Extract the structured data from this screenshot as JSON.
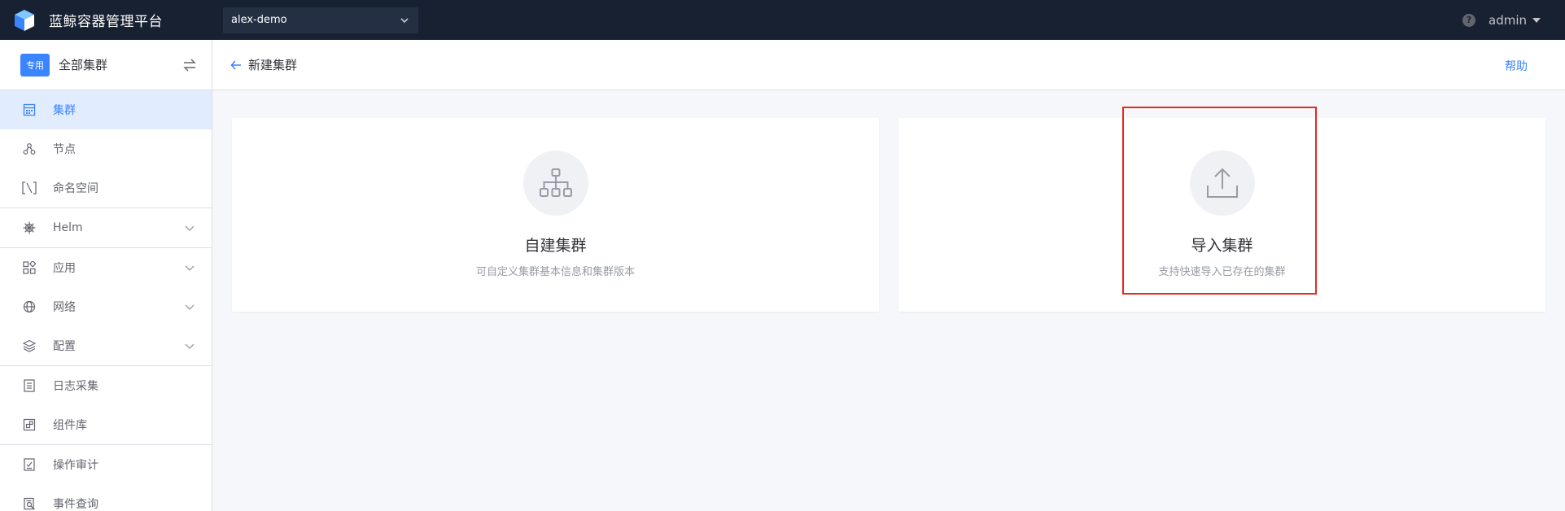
{
  "topbar": {
    "title": "蓝鲸容器管理平台",
    "project": "alex-demo",
    "help_icon_glyph": "?",
    "user": "admin"
  },
  "sidebar": {
    "tag": "专用",
    "cluster": "全部集群",
    "items": [
      {
        "label": "集群",
        "icon": "grid-icon",
        "active": true
      },
      {
        "label": "节点",
        "icon": "nodes-icon"
      },
      {
        "label": "命名空间",
        "icon": "namespace-icon"
      },
      {
        "label": "Helm",
        "icon": "helm-icon",
        "expandable": true
      },
      {
        "label": "应用",
        "icon": "apps-icon",
        "expandable": true
      },
      {
        "label": "网络",
        "icon": "network-icon",
        "expandable": true
      },
      {
        "label": "配置",
        "icon": "layers-icon",
        "expandable": true
      },
      {
        "label": "日志采集",
        "icon": "log-icon"
      },
      {
        "label": "组件库",
        "icon": "component-icon"
      },
      {
        "label": "操作审计",
        "icon": "audit-icon"
      },
      {
        "label": "事件查询",
        "icon": "event-search-icon"
      }
    ]
  },
  "header": {
    "title": "新建集群",
    "help": "帮助"
  },
  "cards": [
    {
      "title": "自建集群",
      "desc": "可自定义集群基本信息和集群版本",
      "icon": "hierarchy-icon"
    },
    {
      "title": "导入集群",
      "desc": "支持快速导入已存在的集群",
      "icon": "upload-icon"
    }
  ],
  "colors": {
    "topbar_bg": "#182132",
    "accent": "#3a84ff",
    "highlight": "#e4291e"
  }
}
